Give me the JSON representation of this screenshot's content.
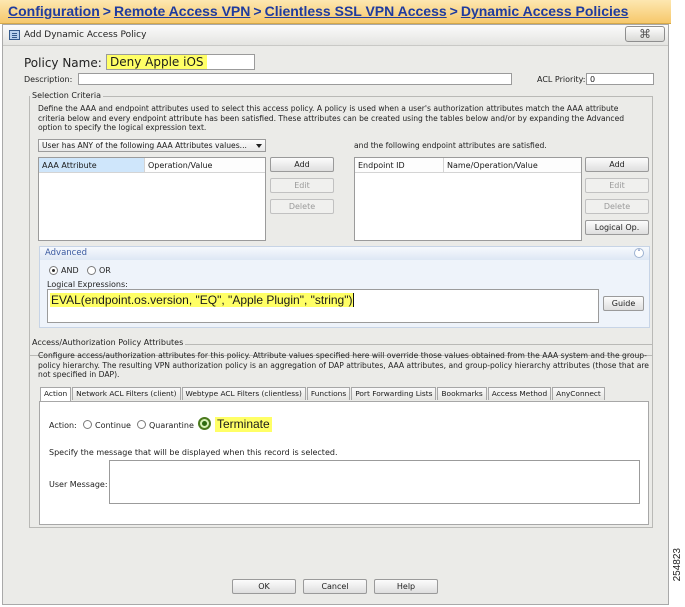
{
  "breadcrumb": {
    "items": [
      "Configuration",
      "Remote Access VPN",
      "Clientless SSL VPN Access",
      "Dynamic Access Policies"
    ],
    "separator": ">"
  },
  "dialog": {
    "title": "Add Dynamic Access Policy",
    "close_label": "⌘"
  },
  "policy": {
    "name_label": "Policy Name:",
    "name_value": "Deny Apple iOS",
    "description_label": "Description:",
    "description_value": "",
    "acl_priority_label": "ACL Priority:",
    "acl_priority_value": "0"
  },
  "selection": {
    "legend": "Selection Criteria",
    "description": "Define the AAA and endpoint attributes used to select this access policy. A policy is used when a user's authorization attributes match the AAA attribute criteria below and every endpoint attribute has been satisfied. These attributes can be created using the tables below and/or by expanding the Advanced option to specify the logical expression text.",
    "match_select": "User has ANY of the following AAA Attributes values...",
    "endpoint_text": "and the following endpoint attributes are satisfied.",
    "aaa_columns": [
      "AAA Attribute",
      "Operation/Value"
    ],
    "endpoint_columns": [
      "Endpoint ID",
      "Name/Operation/Value"
    ],
    "aaa_buttons": {
      "add": "Add",
      "edit": "Edit",
      "delete": "Delete"
    },
    "endpoint_buttons": {
      "add": "Add",
      "edit": "Edit",
      "delete": "Delete",
      "logical": "Logical Op."
    }
  },
  "advanced": {
    "title": "Advanced",
    "and_label": "AND",
    "or_label": "OR",
    "logical_label": "Logical Expressions:",
    "expression": "EVAL(endpoint.os.version, \"EQ\", \"Apple Plugin\", \"string\")",
    "guide_label": "Guide"
  },
  "access": {
    "legend": "Access/Authorization Policy Attributes",
    "description": "Configure access/authorization attributes for this policy. Attribute values specified here will override those values obtained from the AAA system and the group-policy hierarchy. The resulting VPN authorization policy is an aggregation of DAP attributes, AAA attributes, and group-policy hierarchy attributes (those that are not specified in DAP).",
    "tabs": [
      "Action",
      "Network ACL Filters (client)",
      "Webtype ACL Filters (clientless)",
      "Functions",
      "Port Forwarding Lists",
      "Bookmarks",
      "Access Method",
      "AnyConnect"
    ],
    "action_label": "Action:",
    "continue_label": "Continue",
    "quarantine_label": "Quarantine",
    "terminate_label": "Terminate",
    "message_hint": "Specify the message that will be displayed when this record is selected.",
    "user_message_label": "User Message:",
    "user_message_value": ""
  },
  "footer": {
    "ok": "OK",
    "cancel": "Cancel",
    "help": "Help"
  },
  "figure_number": "254823",
  "colors": {
    "highlight": "#ffff66",
    "breadcrumb": "#1f3b9e",
    "terminate_radio": "#2d6a10"
  }
}
